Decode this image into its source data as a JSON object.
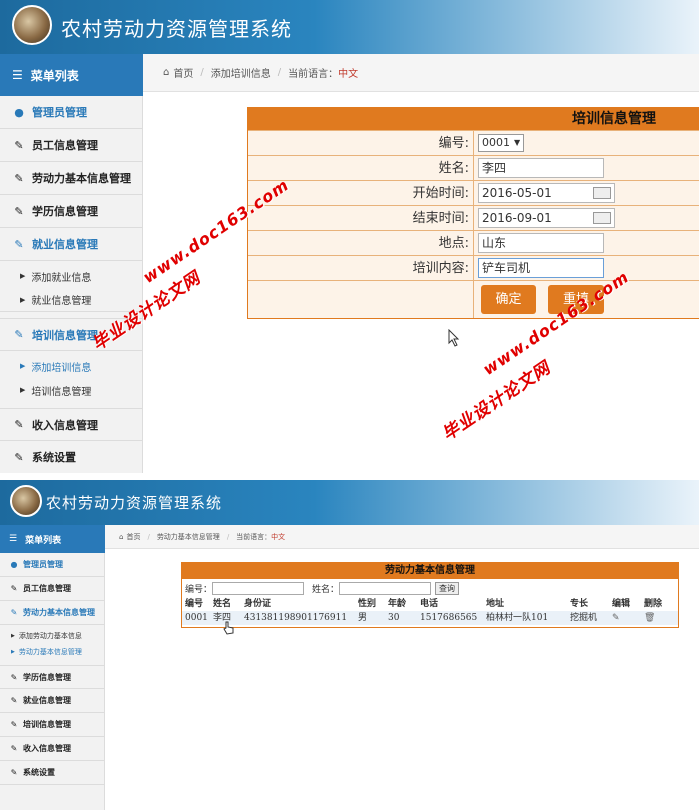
{
  "app_title": "农村劳动力资源管理系统",
  "sidebar": {
    "header": "菜单列表",
    "items_top": [
      {
        "label": "管理员管理",
        "icon": "user-icon"
      },
      {
        "label": "员工信息管理",
        "icon": "edit-icon"
      },
      {
        "label": "劳动力基本信息管理",
        "icon": "edit-icon"
      },
      {
        "label": "学历信息管理",
        "icon": "edit-icon"
      },
      {
        "label": "就业信息管理",
        "icon": "edit-icon"
      }
    ],
    "sub_employment": [
      "添加就业信息",
      "就业信息管理"
    ],
    "item_training": "培训信息管理",
    "sub_training": [
      "添加培训信息",
      "培训信息管理"
    ],
    "items_bottom": [
      "收入信息管理",
      "系统设置"
    ]
  },
  "breadcrumb1": {
    "home": "首页",
    "page": "添加培训信息",
    "lang_label": "当前语言：",
    "lang_value": "中文"
  },
  "form": {
    "title": "培训信息管理",
    "fields": [
      {
        "label": "编号:",
        "value": "0001"
      },
      {
        "label": "姓名:",
        "value": "李四"
      },
      {
        "label": "开始时间:",
        "value": "2016-05-01"
      },
      {
        "label": "结束时间:",
        "value": "2016-09-01"
      },
      {
        "label": "地点:",
        "value": "山东"
      },
      {
        "label": "培训内容:",
        "value": "铲车司机"
      }
    ],
    "confirm": "确定",
    "reset": "重填"
  },
  "watermark": {
    "site": "www.doc163.com",
    "name": "毕业设计论文网"
  },
  "panel2": {
    "sidebar": {
      "header": "菜单列表",
      "items_a": [
        "管理员管理",
        "员工信息管理",
        "劳动力基本信息管理"
      ],
      "subs": [
        "添加劳动力基本信息",
        "劳动力基本信息管理"
      ],
      "items_b": [
        "学历信息管理",
        "就业信息管理",
        "培训信息管理",
        "收入信息管理",
        "系统设置"
      ]
    },
    "breadcrumb": {
      "home": "首页",
      "page": "劳动力基本信息管理",
      "lang_label": "当前语言：",
      "lang_value": "中文"
    },
    "table": {
      "title": "劳动力基本信息管理",
      "search_id_label": "编号：",
      "search_name_label": "姓名：",
      "search_button": "查询",
      "headers": [
        "编号",
        "姓名",
        "身份证",
        "性别",
        "年龄",
        "电话",
        "地址",
        "专长",
        "编辑",
        "删除"
      ],
      "rows": [
        [
          "0001",
          "李四",
          "431381198901176911",
          "男",
          "30",
          "1517686565",
          "柏林村一队101",
          "挖掘机"
        ]
      ]
    }
  },
  "colors": {
    "accent": "#e07a1f",
    "primary": "#2979b8",
    "watermark": "#e00000"
  }
}
